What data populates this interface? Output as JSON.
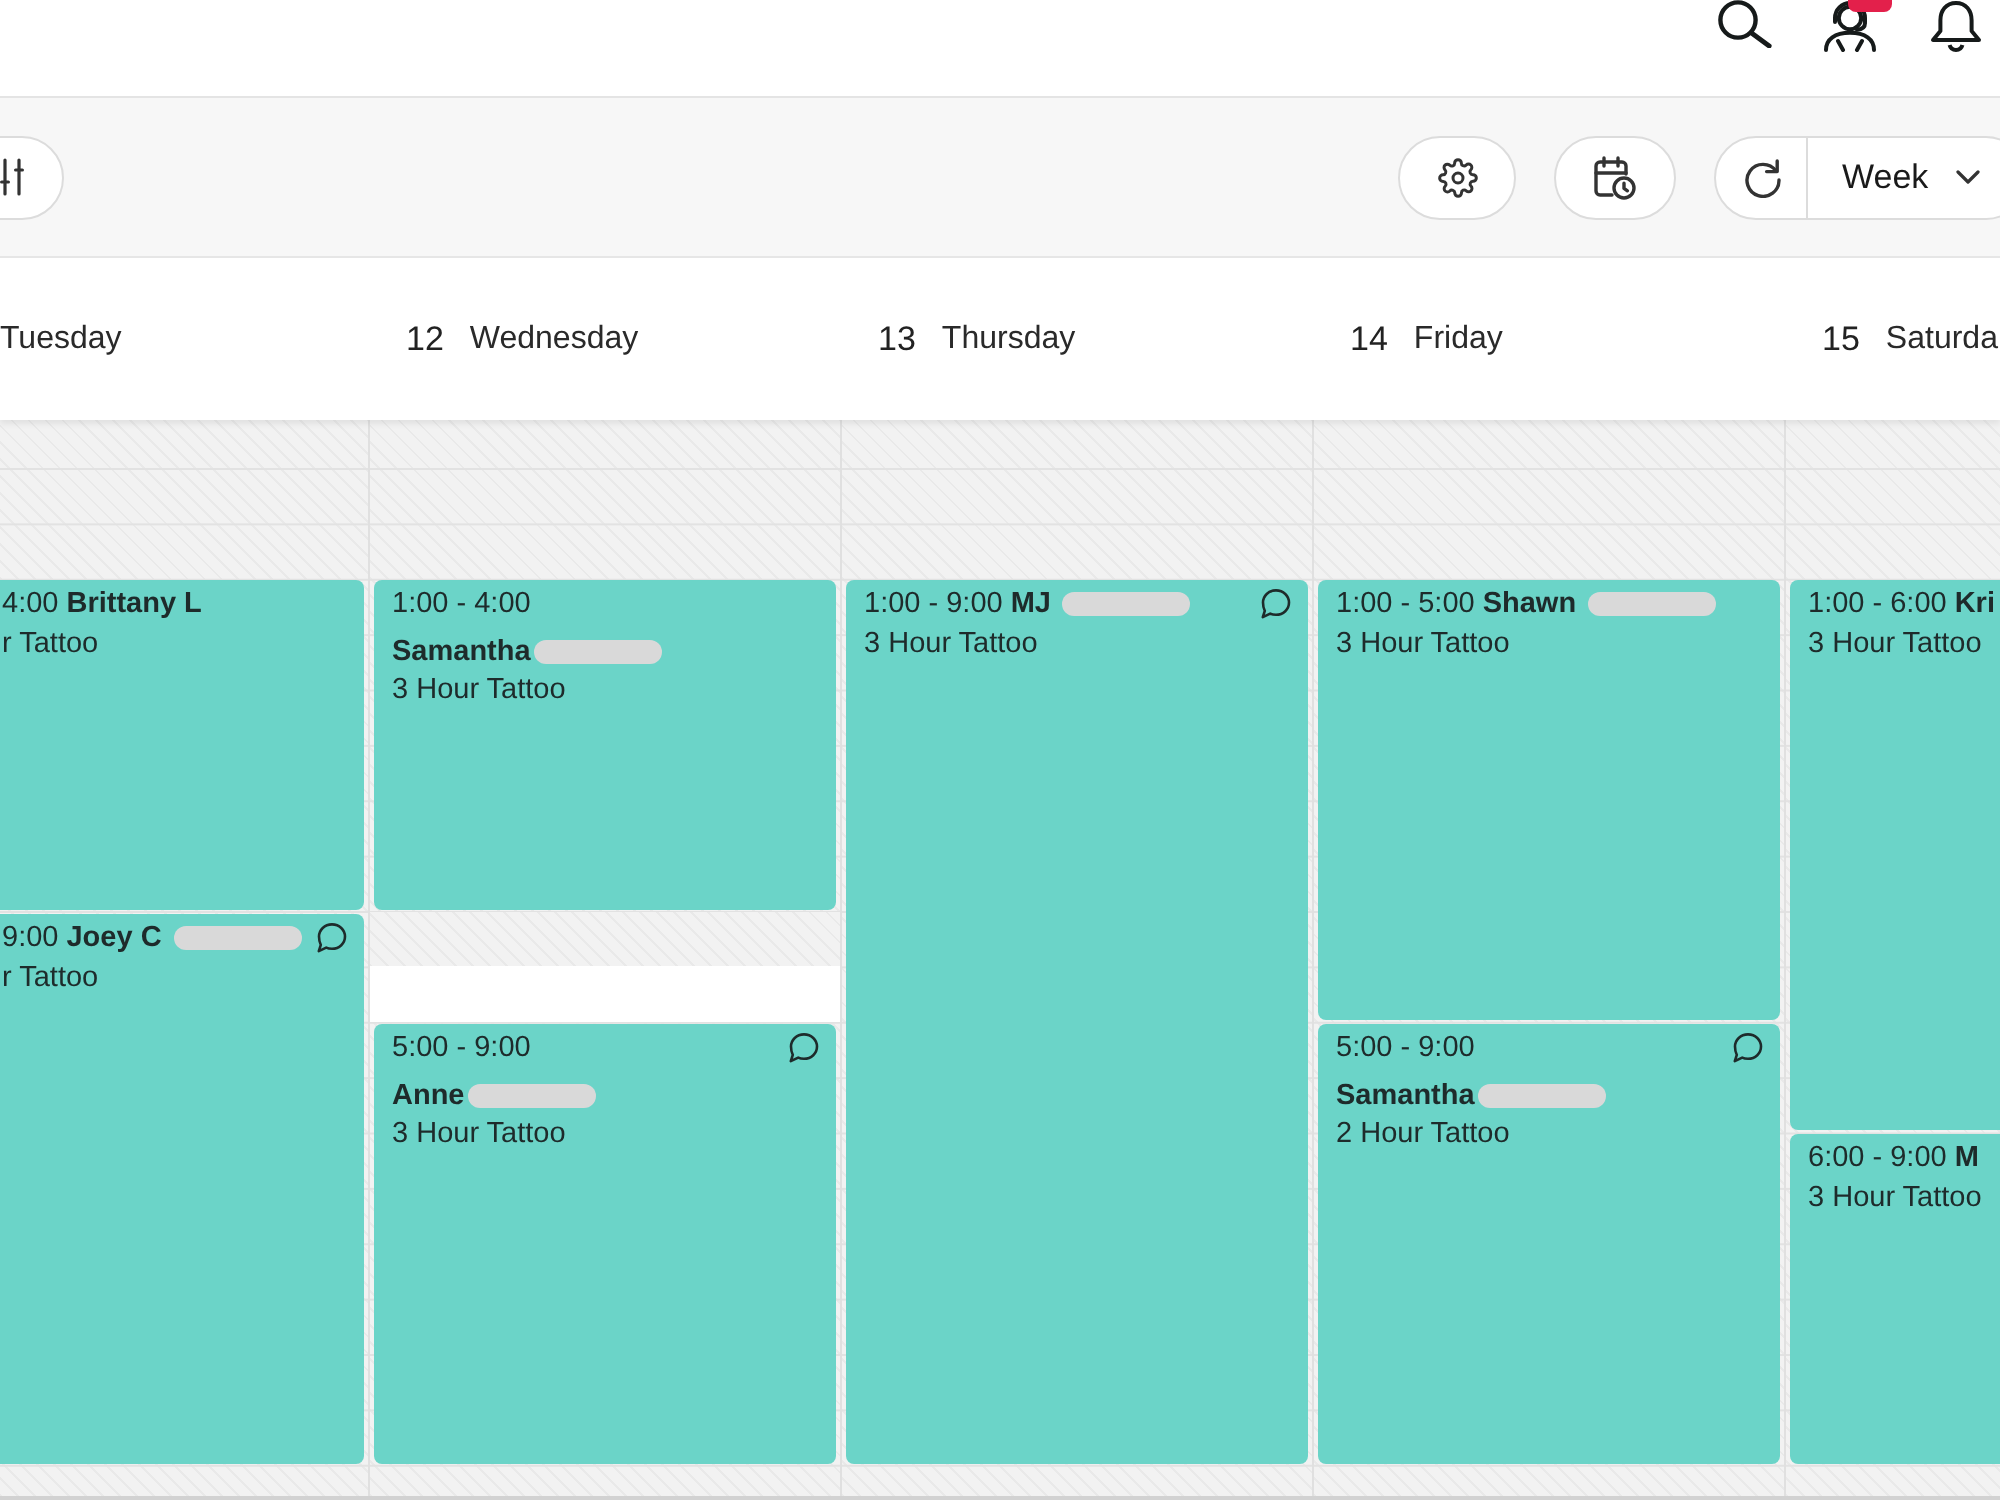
{
  "top_bar": {
    "icons": [
      {
        "kind": "search",
        "badge": false
      },
      {
        "kind": "support",
        "badge": true
      },
      {
        "kind": "bell",
        "badge": false
      }
    ]
  },
  "toolbar": {
    "left_buttons": [
      {
        "kind": "filters"
      }
    ],
    "right_buttons": [
      {
        "kind": "settings"
      },
      {
        "kind": "schedule"
      }
    ],
    "view_control": {
      "buttons": [
        {
          "kind": "refresh"
        }
      ],
      "select": {
        "value": "Week"
      }
    }
  },
  "days": [
    {
      "day": "Tuesday",
      "slots": [
        {
          "kind": "inline",
          "time": "4:00",
          "name": "Brittany L",
          "redacted": false,
          "service": "r Tattoo",
          "has_note": false
        },
        {
          "kind": "inline",
          "time": "9:00",
          "name": "Joey C",
          "redacted": true,
          "service": "r Tattoo",
          "has_note": true
        }
      ]
    },
    {
      "number": "12",
      "day": "Wednesday",
      "slots": [
        {
          "kind": "stacked",
          "time": "1:00 - 4:00",
          "name": "Samantha",
          "redacted": true,
          "service": "3 Hour Tattoo",
          "has_note": false
        },
        {
          "kind": "blocked"
        },
        {
          "kind": "open"
        },
        {
          "kind": "stacked",
          "time": "5:00 - 9:00",
          "name": "Anne",
          "redacted": true,
          "service": "3 Hour Tattoo",
          "has_note": true
        }
      ]
    },
    {
      "number": "13",
      "day": "Thursday",
      "slots": [
        {
          "kind": "inline",
          "time": "1:00 - 9:00",
          "name": "MJ",
          "redacted": true,
          "service": "3 Hour Tattoo",
          "has_note": true
        }
      ]
    },
    {
      "number": "14",
      "day": "Friday",
      "slots": [
        {
          "kind": "inline",
          "time": "1:00 - 5:00",
          "name": "Shawn",
          "redacted": true,
          "service": "3 Hour Tattoo",
          "has_note": false
        },
        {
          "kind": "stacked",
          "time": "5:00 - 9:00",
          "name": "Samantha",
          "redacted": true,
          "service": "2 Hour Tattoo",
          "has_note": true
        }
      ]
    },
    {
      "number": "15",
      "day": "Saturda",
      "slots": [
        {
          "kind": "inline",
          "time": "1:00 - 6:00",
          "name": "Kri",
          "redacted": false,
          "service": "3 Hour Tattoo",
          "has_note": false
        },
        {
          "kind": "inline",
          "time": "6:00 - 9:00",
          "name": "M",
          "redacted": false,
          "service": "3 Hour Tattoo",
          "has_note": false
        }
      ]
    }
  ]
}
